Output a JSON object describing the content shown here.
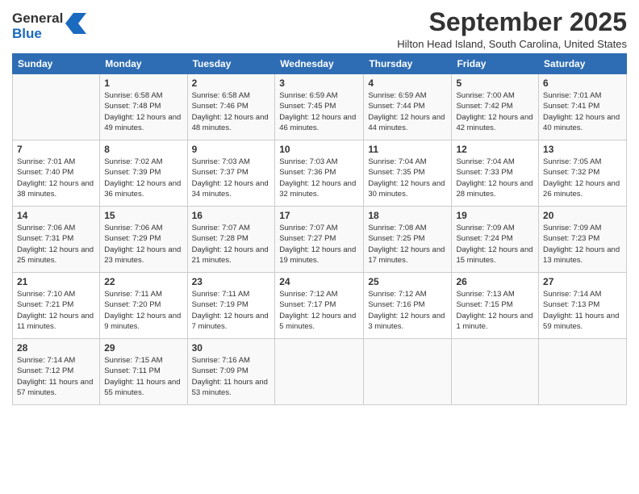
{
  "header": {
    "logo": {
      "line1": "General",
      "line2": "Blue"
    },
    "title": "September 2025",
    "location": "Hilton Head Island, South Carolina, United States"
  },
  "days_of_week": [
    "Sunday",
    "Monday",
    "Tuesday",
    "Wednesday",
    "Thursday",
    "Friday",
    "Saturday"
  ],
  "weeks": [
    [
      {
        "day": "",
        "sunrise": "",
        "sunset": "",
        "daylight": ""
      },
      {
        "day": "1",
        "sunrise": "Sunrise: 6:58 AM",
        "sunset": "Sunset: 7:48 PM",
        "daylight": "Daylight: 12 hours and 49 minutes."
      },
      {
        "day": "2",
        "sunrise": "Sunrise: 6:58 AM",
        "sunset": "Sunset: 7:46 PM",
        "daylight": "Daylight: 12 hours and 48 minutes."
      },
      {
        "day": "3",
        "sunrise": "Sunrise: 6:59 AM",
        "sunset": "Sunset: 7:45 PM",
        "daylight": "Daylight: 12 hours and 46 minutes."
      },
      {
        "day": "4",
        "sunrise": "Sunrise: 6:59 AM",
        "sunset": "Sunset: 7:44 PM",
        "daylight": "Daylight: 12 hours and 44 minutes."
      },
      {
        "day": "5",
        "sunrise": "Sunrise: 7:00 AM",
        "sunset": "Sunset: 7:42 PM",
        "daylight": "Daylight: 12 hours and 42 minutes."
      },
      {
        "day": "6",
        "sunrise": "Sunrise: 7:01 AM",
        "sunset": "Sunset: 7:41 PM",
        "daylight": "Daylight: 12 hours and 40 minutes."
      }
    ],
    [
      {
        "day": "7",
        "sunrise": "Sunrise: 7:01 AM",
        "sunset": "Sunset: 7:40 PM",
        "daylight": "Daylight: 12 hours and 38 minutes."
      },
      {
        "day": "8",
        "sunrise": "Sunrise: 7:02 AM",
        "sunset": "Sunset: 7:39 PM",
        "daylight": "Daylight: 12 hours and 36 minutes."
      },
      {
        "day": "9",
        "sunrise": "Sunrise: 7:03 AM",
        "sunset": "Sunset: 7:37 PM",
        "daylight": "Daylight: 12 hours and 34 minutes."
      },
      {
        "day": "10",
        "sunrise": "Sunrise: 7:03 AM",
        "sunset": "Sunset: 7:36 PM",
        "daylight": "Daylight: 12 hours and 32 minutes."
      },
      {
        "day": "11",
        "sunrise": "Sunrise: 7:04 AM",
        "sunset": "Sunset: 7:35 PM",
        "daylight": "Daylight: 12 hours and 30 minutes."
      },
      {
        "day": "12",
        "sunrise": "Sunrise: 7:04 AM",
        "sunset": "Sunset: 7:33 PM",
        "daylight": "Daylight: 12 hours and 28 minutes."
      },
      {
        "day": "13",
        "sunrise": "Sunrise: 7:05 AM",
        "sunset": "Sunset: 7:32 PM",
        "daylight": "Daylight: 12 hours and 26 minutes."
      }
    ],
    [
      {
        "day": "14",
        "sunrise": "Sunrise: 7:06 AM",
        "sunset": "Sunset: 7:31 PM",
        "daylight": "Daylight: 12 hours and 25 minutes."
      },
      {
        "day": "15",
        "sunrise": "Sunrise: 7:06 AM",
        "sunset": "Sunset: 7:29 PM",
        "daylight": "Daylight: 12 hours and 23 minutes."
      },
      {
        "day": "16",
        "sunrise": "Sunrise: 7:07 AM",
        "sunset": "Sunset: 7:28 PM",
        "daylight": "Daylight: 12 hours and 21 minutes."
      },
      {
        "day": "17",
        "sunrise": "Sunrise: 7:07 AM",
        "sunset": "Sunset: 7:27 PM",
        "daylight": "Daylight: 12 hours and 19 minutes."
      },
      {
        "day": "18",
        "sunrise": "Sunrise: 7:08 AM",
        "sunset": "Sunset: 7:25 PM",
        "daylight": "Daylight: 12 hours and 17 minutes."
      },
      {
        "day": "19",
        "sunrise": "Sunrise: 7:09 AM",
        "sunset": "Sunset: 7:24 PM",
        "daylight": "Daylight: 12 hours and 15 minutes."
      },
      {
        "day": "20",
        "sunrise": "Sunrise: 7:09 AM",
        "sunset": "Sunset: 7:23 PM",
        "daylight": "Daylight: 12 hours and 13 minutes."
      }
    ],
    [
      {
        "day": "21",
        "sunrise": "Sunrise: 7:10 AM",
        "sunset": "Sunset: 7:21 PM",
        "daylight": "Daylight: 12 hours and 11 minutes."
      },
      {
        "day": "22",
        "sunrise": "Sunrise: 7:11 AM",
        "sunset": "Sunset: 7:20 PM",
        "daylight": "Daylight: 12 hours and 9 minutes."
      },
      {
        "day": "23",
        "sunrise": "Sunrise: 7:11 AM",
        "sunset": "Sunset: 7:19 PM",
        "daylight": "Daylight: 12 hours and 7 minutes."
      },
      {
        "day": "24",
        "sunrise": "Sunrise: 7:12 AM",
        "sunset": "Sunset: 7:17 PM",
        "daylight": "Daylight: 12 hours and 5 minutes."
      },
      {
        "day": "25",
        "sunrise": "Sunrise: 7:12 AM",
        "sunset": "Sunset: 7:16 PM",
        "daylight": "Daylight: 12 hours and 3 minutes."
      },
      {
        "day": "26",
        "sunrise": "Sunrise: 7:13 AM",
        "sunset": "Sunset: 7:15 PM",
        "daylight": "Daylight: 12 hours and 1 minute."
      },
      {
        "day": "27",
        "sunrise": "Sunrise: 7:14 AM",
        "sunset": "Sunset: 7:13 PM",
        "daylight": "Daylight: 11 hours and 59 minutes."
      }
    ],
    [
      {
        "day": "28",
        "sunrise": "Sunrise: 7:14 AM",
        "sunset": "Sunset: 7:12 PM",
        "daylight": "Daylight: 11 hours and 57 minutes."
      },
      {
        "day": "29",
        "sunrise": "Sunrise: 7:15 AM",
        "sunset": "Sunset: 7:11 PM",
        "daylight": "Daylight: 11 hours and 55 minutes."
      },
      {
        "day": "30",
        "sunrise": "Sunrise: 7:16 AM",
        "sunset": "Sunset: 7:09 PM",
        "daylight": "Daylight: 11 hours and 53 minutes."
      },
      {
        "day": "",
        "sunrise": "",
        "sunset": "",
        "daylight": ""
      },
      {
        "day": "",
        "sunrise": "",
        "sunset": "",
        "daylight": ""
      },
      {
        "day": "",
        "sunrise": "",
        "sunset": "",
        "daylight": ""
      },
      {
        "day": "",
        "sunrise": "",
        "sunset": "",
        "daylight": ""
      }
    ]
  ]
}
